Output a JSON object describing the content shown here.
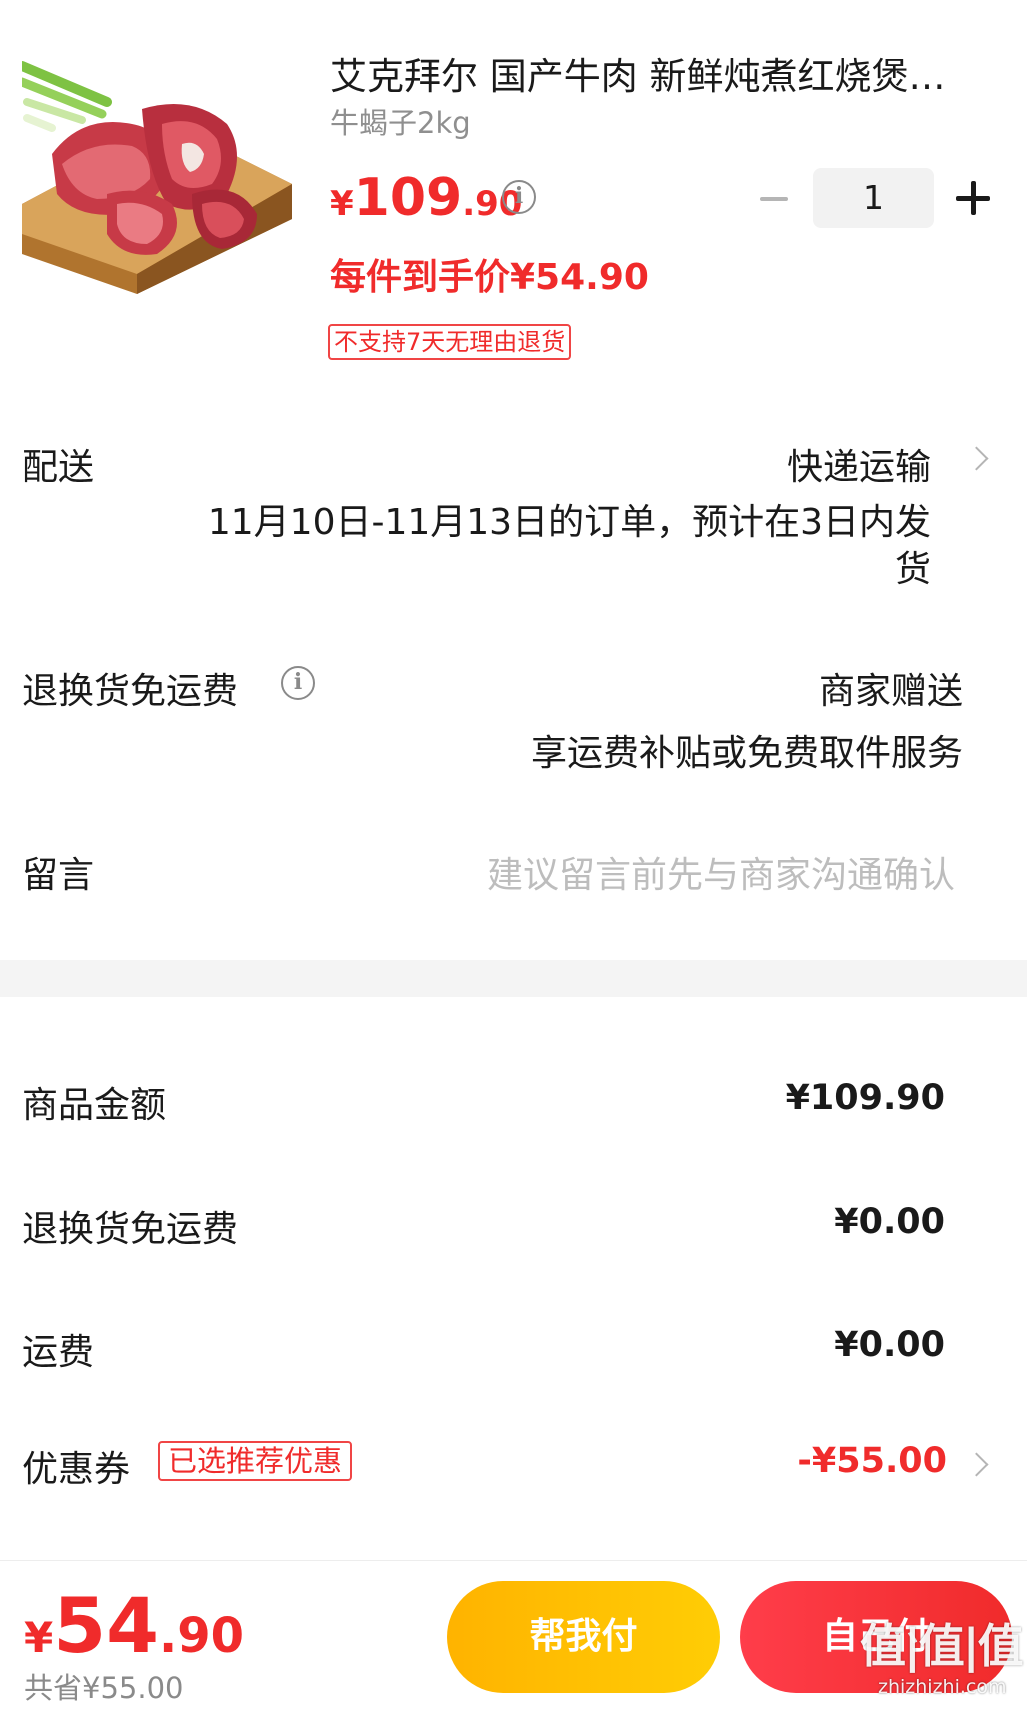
{
  "product": {
    "title": "艾克拜尔 国产牛肉 新鲜炖煮红烧煲…",
    "spec": "牛蝎子2kg",
    "price_currency": "¥",
    "price_int": "109",
    "price_dec": ".90",
    "quantity": "1",
    "final_price": "每件到手价¥54.90",
    "no_return_tag": "不支持7天无理由退货",
    "image_icon": "beef-product-image"
  },
  "delivery": {
    "label": "配送",
    "method": "快递运输",
    "note_line1": "11月10日-11月13日的订单，预计在3日内发",
    "note_line2": "货"
  },
  "return_shipping": {
    "label": "退换货免运费",
    "value": "商家赠送",
    "note": "享运费补贴或免费取件服务"
  },
  "message": {
    "label": "留言",
    "placeholder": "建议留言前先与商家沟通确认"
  },
  "summary": {
    "goods_label": "商品金额",
    "goods_value": "¥109.90",
    "return_label": "退换货免运费",
    "return_value": "¥0.00",
    "shipping_label": "运费",
    "shipping_value": "¥0.00",
    "coupon_label": "优惠券",
    "coupon_tag": "已选推荐优惠",
    "coupon_value": "-¥55.00"
  },
  "bottom": {
    "total_currency": "¥",
    "total_int": "54",
    "total_dec": ".90",
    "saved": "共省¥55.00",
    "help_pay": "帮我付",
    "self_pay": "自己付"
  },
  "watermark": {
    "main": "值|值|值",
    "sub": "zhizhizhi.com"
  },
  "colors": {
    "accent_red": "#f02b2b",
    "help_orange": "#ffc107",
    "muted_gray": "#8f8f8f",
    "placeholder_gray": "#bdbdbd"
  }
}
